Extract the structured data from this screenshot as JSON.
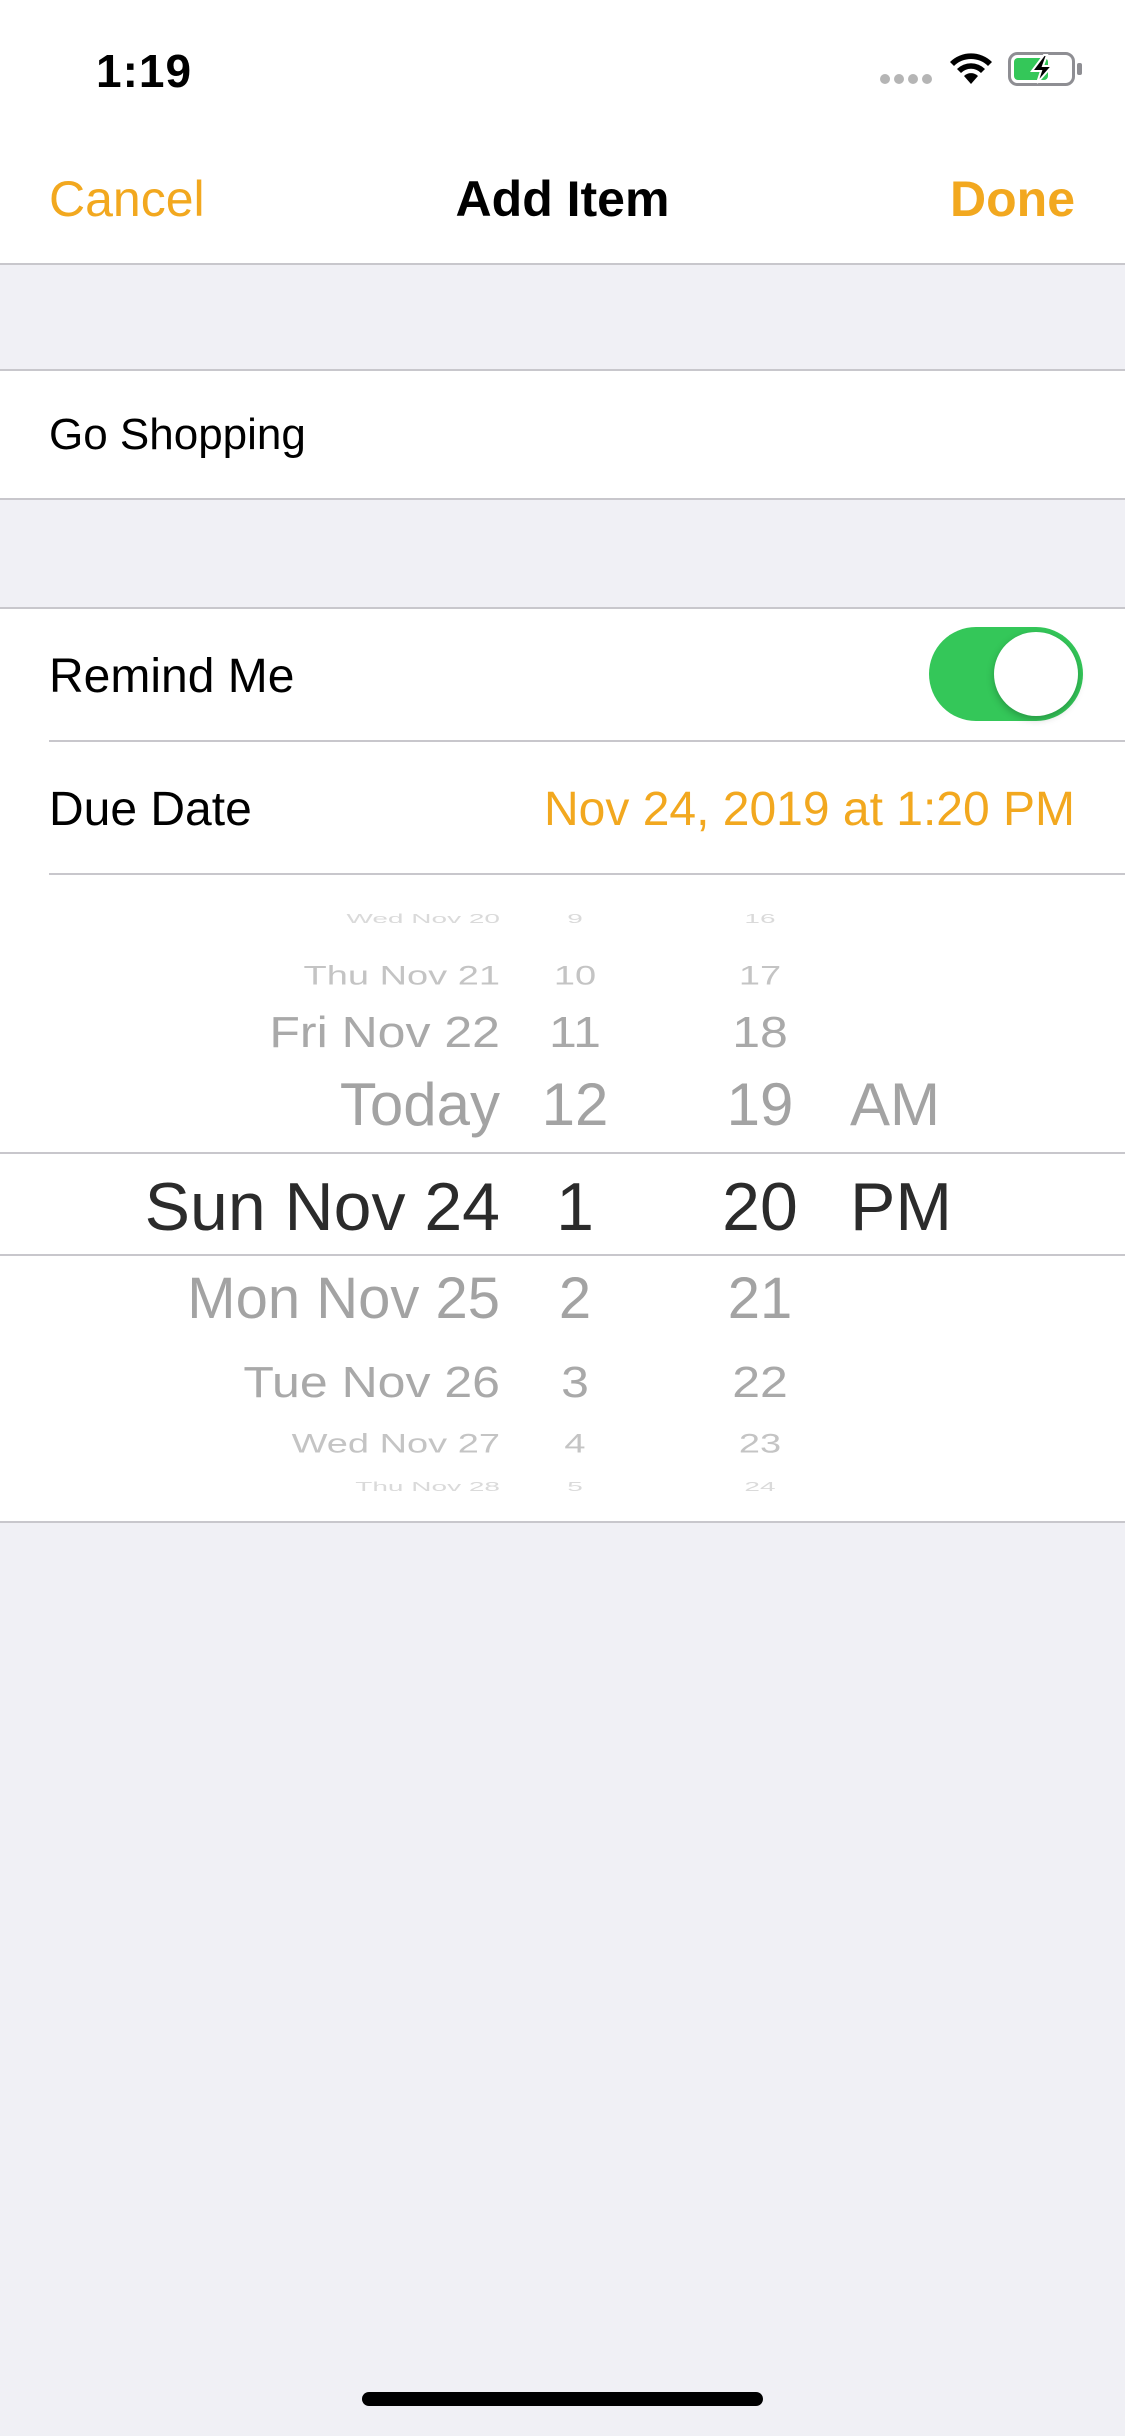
{
  "status_bar": {
    "time": "1:19",
    "icons": [
      "cellular-signal-icon",
      "wifi-icon",
      "battery-charging-icon"
    ],
    "battery_color": "#34c759"
  },
  "nav": {
    "cancel_label": "Cancel",
    "title": "Add Item",
    "done_label": "Done"
  },
  "item": {
    "title_value": "Go Shopping"
  },
  "reminder": {
    "remind_label": "Remind Me",
    "remind_enabled": true,
    "due_label": "Due Date",
    "due_value": "Nov 24, 2019 at 1:20 PM"
  },
  "picker": {
    "dates": [
      "Wed Nov 20",
      "Thu Nov 21",
      "Fri Nov 22",
      "Today",
      "Sun Nov 24",
      "Mon Nov 25",
      "Tue Nov 26",
      "Wed Nov 27",
      "Thu Nov 28"
    ],
    "hours": [
      "9",
      "10",
      "11",
      "12",
      "1",
      "2",
      "3",
      "4",
      "5"
    ],
    "minutes": [
      "16",
      "17",
      "18",
      "19",
      "20",
      "21",
      "22",
      "23",
      "24"
    ],
    "ampm": [
      "AM",
      "PM"
    ],
    "selected": {
      "date": "Sun Nov 24",
      "hour": "1",
      "minute": "20",
      "ampm": "PM"
    }
  },
  "colors": {
    "accent": "#f2a81f",
    "toggle_on": "#34c759",
    "background": "#f0f0f5"
  }
}
